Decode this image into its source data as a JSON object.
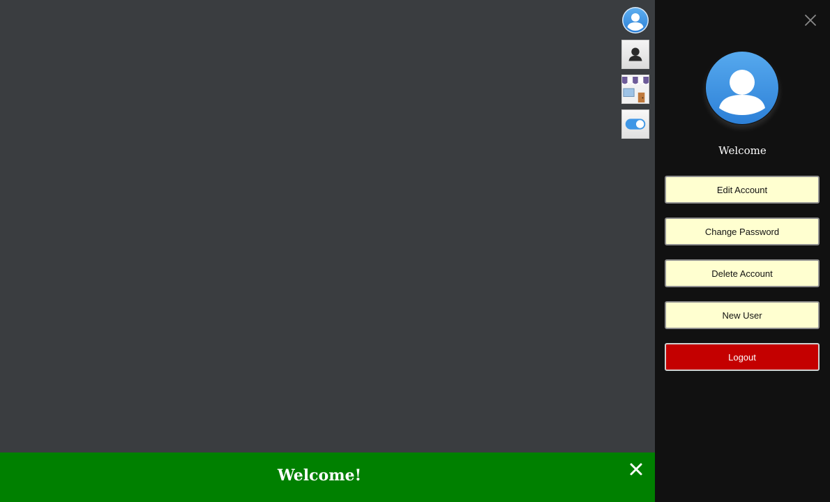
{
  "toolbar": {
    "items": [
      {
        "icon": "user-avatar-icon"
      },
      {
        "icon": "person-silhouette-icon"
      },
      {
        "icon": "storefront-icon"
      },
      {
        "icon": "toggle-switch-icon"
      }
    ]
  },
  "account_panel": {
    "close_icon": "close-icon",
    "avatar_icon": "user-avatar-icon",
    "welcome": "Welcome",
    "buttons": {
      "edit_account": "Edit Account",
      "change_password": "Change Password",
      "delete_account": "Delete Account",
      "new_user": "New User",
      "logout": "Logout"
    }
  },
  "banner": {
    "message": "Welcome!",
    "close_icon": "close-icon"
  },
  "colors": {
    "stage_background": "#3a3d40",
    "panel_background": "#111111",
    "menu_button": "#ffffd0",
    "logout_button": "#c40000",
    "banner_background": "#008000",
    "avatar_blue": "#3f97e6"
  }
}
